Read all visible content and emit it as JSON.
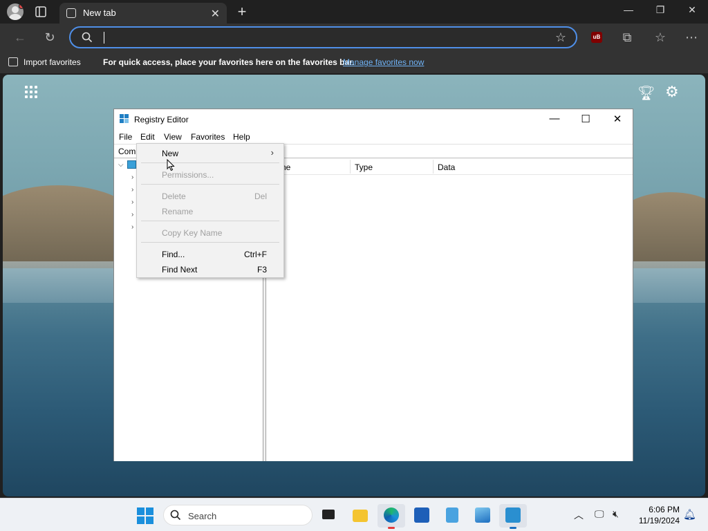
{
  "browser": {
    "tab_title": "New tab",
    "address_value": "",
    "favorites_bar": {
      "import_label": "Import favorites",
      "message": "For quick access, place your favorites here on the favorites bar.",
      "manage_link": "Manage favorites now"
    },
    "extension_badge": "uB"
  },
  "regedit": {
    "title": "Registry Editor",
    "menu": [
      "File",
      "Edit",
      "View",
      "Favorites",
      "Help"
    ],
    "address_text": "Com",
    "columns": [
      "ne",
      "Type",
      "Data"
    ]
  },
  "context_menu": {
    "items": [
      {
        "label": "New",
        "shortcut": "",
        "disabled": false,
        "submenu": true
      },
      {
        "label": "Permissions...",
        "shortcut": "",
        "disabled": true
      },
      {
        "label": "Delete",
        "shortcut": "Del",
        "disabled": true
      },
      {
        "label": "Rename",
        "shortcut": "",
        "disabled": true
      },
      {
        "label": "Copy Key Name",
        "shortcut": "",
        "disabled": true
      },
      {
        "label": "Find...",
        "shortcut": "Ctrl+F",
        "disabled": false
      },
      {
        "label": "Find Next",
        "shortcut": "F3",
        "disabled": false
      }
    ]
  },
  "taskbar": {
    "search_label": "Search",
    "time": "6:06 PM",
    "date": "11/19/2024"
  },
  "colors": {
    "accent": "#4f8fe8",
    "link": "#6fb2f5",
    "windows_blue": "#1a8fdc"
  }
}
